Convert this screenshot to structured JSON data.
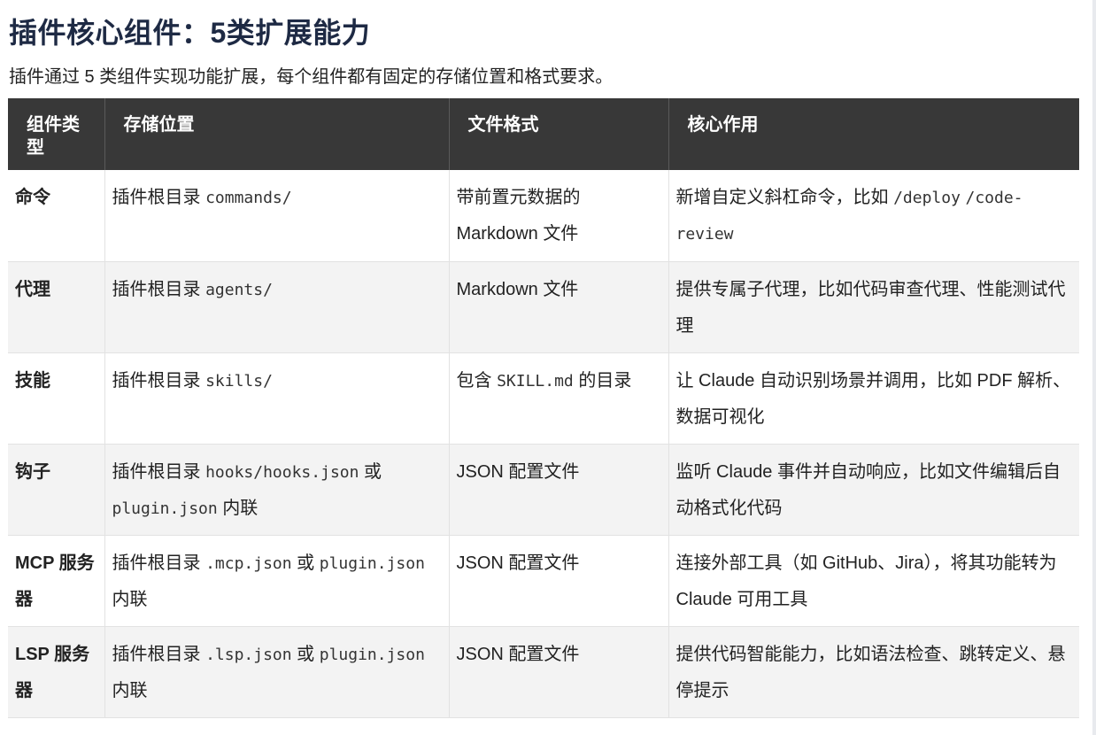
{
  "heading": "插件核心组件：5类扩展能力",
  "intro": "插件通过 5 类组件实现功能扩展，每个组件都有固定的存储位置和格式要求。",
  "table": {
    "headers": [
      "组件类型",
      "存储位置",
      "文件格式",
      "核心作用"
    ],
    "rows": [
      {
        "type": "命令",
        "loc_prefix": "插件根目录 ",
        "loc_code1": "commands/",
        "loc_mid": "",
        "loc_code2": "",
        "loc_suffix": "",
        "fmt_prefix": "带前置元数据的 Markdown 文件",
        "fmt_code": "",
        "fmt_suffix": "",
        "role_prefix": "新增自定义斜杠命令，比如 ",
        "role_code1": "/deploy",
        "role_mid": " ",
        "role_code2": "/code-review",
        "role_suffix": ""
      },
      {
        "type": "代理",
        "loc_prefix": "插件根目录 ",
        "loc_code1": "agents/",
        "loc_mid": "",
        "loc_code2": "",
        "loc_suffix": "",
        "fmt_prefix": "Markdown 文件",
        "fmt_code": "",
        "fmt_suffix": "",
        "role_prefix": "提供专属子代理，比如代码审查代理、性能测试代理",
        "role_code1": "",
        "role_mid": "",
        "role_code2": "",
        "role_suffix": ""
      },
      {
        "type": "技能",
        "loc_prefix": "插件根目录 ",
        "loc_code1": "skills/",
        "loc_mid": "",
        "loc_code2": "",
        "loc_suffix": "",
        "fmt_prefix": "包含 ",
        "fmt_code": "SKILL.md",
        "fmt_suffix": " 的目录",
        "role_prefix": "让 Claude 自动识别场景并调用，比如 PDF 解析、数据可视化",
        "role_code1": "",
        "role_mid": "",
        "role_code2": "",
        "role_suffix": ""
      },
      {
        "type": "钩子",
        "loc_prefix": "插件根目录 ",
        "loc_code1": "hooks/hooks.json",
        "loc_mid": " 或 ",
        "loc_code2": "plugin.json",
        "loc_suffix": " 内联",
        "fmt_prefix": "JSON 配置文件",
        "fmt_code": "",
        "fmt_suffix": "",
        "role_prefix": "监听 Claude 事件并自动响应，比如文件编辑后自动格式化代码",
        "role_code1": "",
        "role_mid": "",
        "role_code2": "",
        "role_suffix": ""
      },
      {
        "type": "MCP 服务器",
        "loc_prefix": "插件根目录 ",
        "loc_code1": ".mcp.json",
        "loc_mid": " 或 ",
        "loc_code2": "plugin.json",
        "loc_suffix": " 内联",
        "fmt_prefix": "JSON 配置文件",
        "fmt_code": "",
        "fmt_suffix": "",
        "role_prefix": "连接外部工具（如 GitHub、Jira），将其功能转为 Claude 可用工具",
        "role_code1": "",
        "role_mid": "",
        "role_code2": "",
        "role_suffix": ""
      },
      {
        "type": "LSP 服务器",
        "loc_prefix": "插件根目录 ",
        "loc_code1": ".lsp.json",
        "loc_mid": " 或 ",
        "loc_code2": "plugin.json",
        "loc_suffix": " 内联",
        "fmt_prefix": "JSON 配置文件",
        "fmt_code": "",
        "fmt_suffix": "",
        "role_prefix": "提供代码智能能力，比如语法检查、跳转定义、悬停提示",
        "role_code1": "",
        "role_mid": "",
        "role_code2": "",
        "role_suffix": ""
      }
    ]
  }
}
